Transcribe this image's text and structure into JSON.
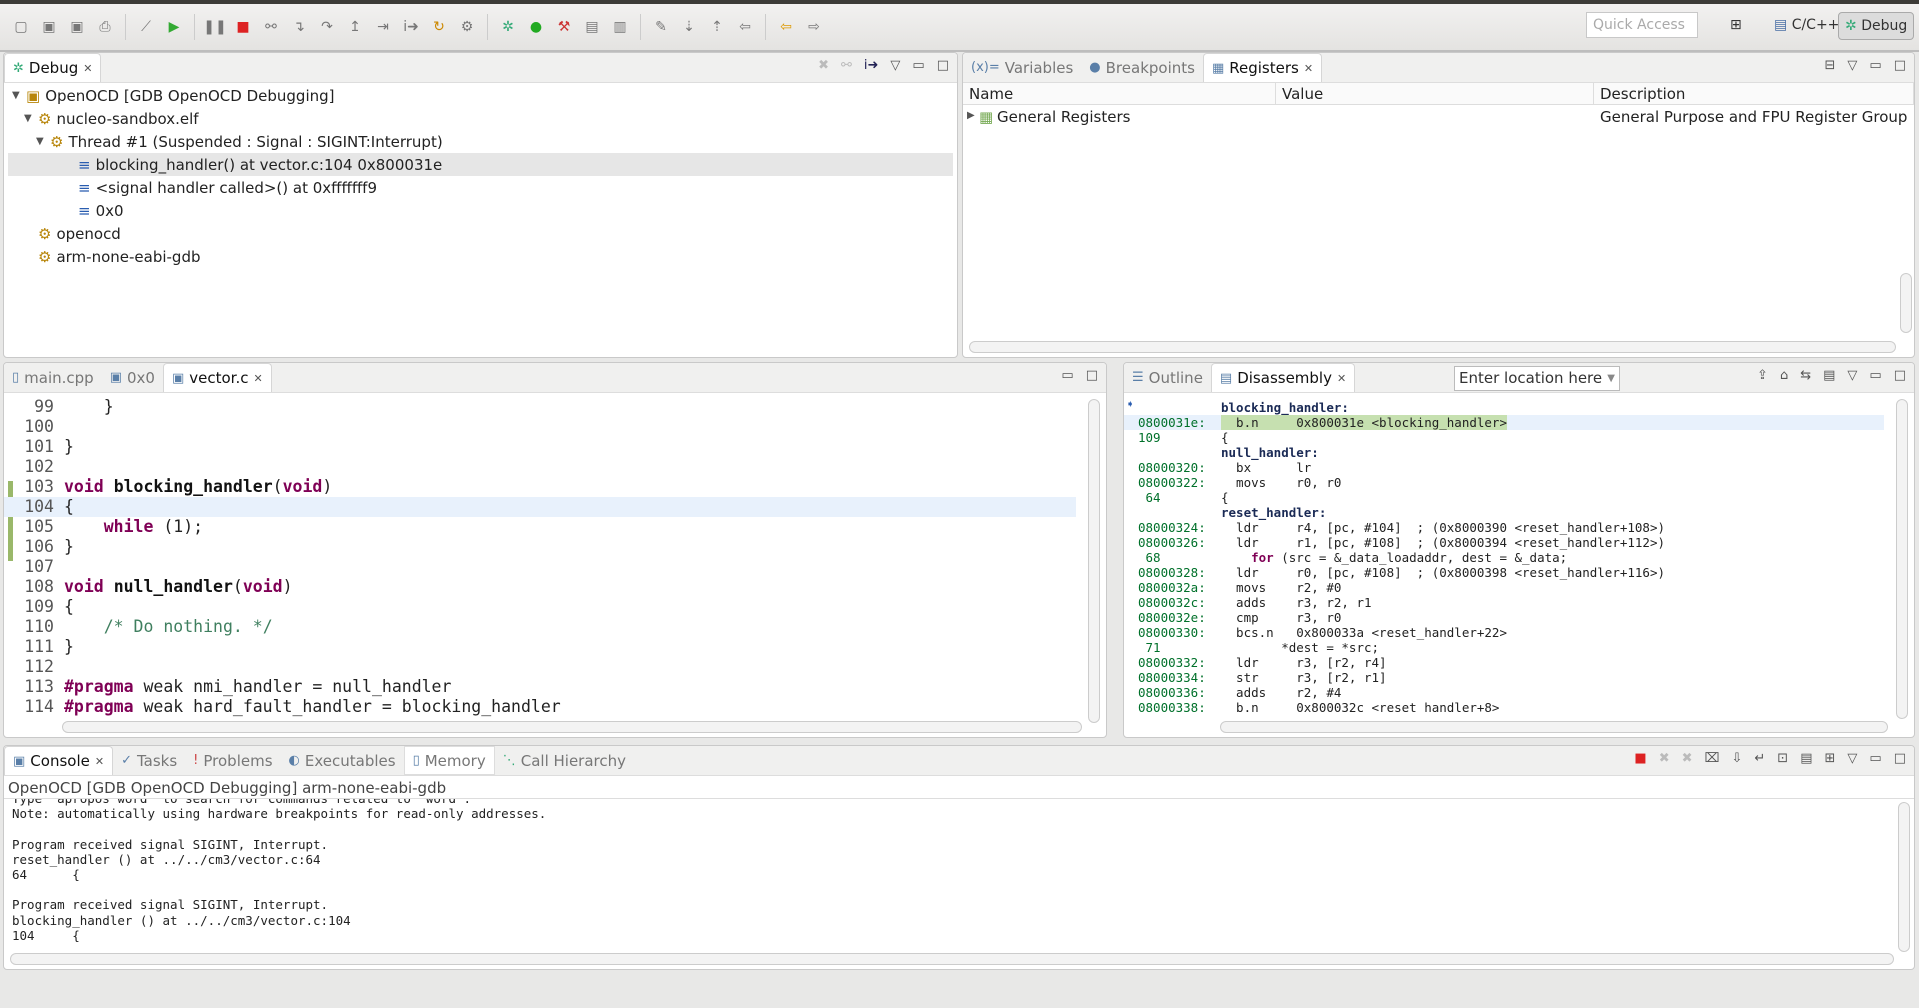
{
  "toolbar": {
    "quick_access_placeholder": "Quick Access",
    "perspectives": [
      "C/C++",
      "Debug"
    ],
    "icons": [
      "new",
      "save",
      "save-all",
      "print",
      "skip-breakpoints",
      "resume",
      "suspend",
      "terminate",
      "disconnect",
      "step-into",
      "step-over",
      "step-return",
      "drop-to-frame",
      "instruction-stepping",
      "run-last",
      "debug-config",
      "bug",
      "run",
      "external-tools",
      "open-type",
      "open-resource",
      "search",
      "next-annotation",
      "previous-annotation",
      "last-edit",
      "back",
      "forward"
    ]
  },
  "debug": {
    "tab": "Debug",
    "tree": [
      {
        "label": "OpenOCD [GDB OpenOCD Debugging]",
        "level": 0,
        "icon": "launch-icon"
      },
      {
        "label": "nucleo-sandbox.elf",
        "level": 1,
        "icon": "process-icon"
      },
      {
        "label": "Thread #1 (Suspended : Signal : SIGINT:Interrupt)",
        "level": 2,
        "icon": "thread-icon"
      },
      {
        "label": "blocking_handler() at vector.c:104 0x800031e",
        "level": 3,
        "icon": "stack-frame-icon",
        "selected": true
      },
      {
        "label": "<signal handler called>() at 0xfffffff9",
        "level": 3,
        "icon": "stack-frame-icon"
      },
      {
        "label": "0x0",
        "level": 3,
        "icon": "stack-frame-icon"
      },
      {
        "label": "openocd",
        "level": 1,
        "icon": "process-icon"
      },
      {
        "label": "arm-none-eabi-gdb",
        "level": 1,
        "icon": "process-icon"
      }
    ]
  },
  "registers": {
    "tabs": [
      "Variables",
      "Breakpoints",
      "Registers"
    ],
    "columns": [
      "Name",
      "Value",
      "Description"
    ],
    "rows": [
      {
        "name": "General Registers",
        "value": "",
        "description": "General Purpose and FPU Register Group"
      }
    ]
  },
  "editor": {
    "tabs": [
      "main.cpp",
      "0x0",
      "vector.c"
    ],
    "lines": [
      {
        "n": "99",
        "t": "    }"
      },
      {
        "n": "100",
        "t": ""
      },
      {
        "n": "101",
        "t": "}"
      },
      {
        "n": "102",
        "t": ""
      },
      {
        "n": "103",
        "t": "void blocking_handler(void)"
      },
      {
        "n": "104",
        "t": "{"
      },
      {
        "n": "105",
        "t": "    while (1);"
      },
      {
        "n": "106",
        "t": "}"
      },
      {
        "n": "107",
        "t": ""
      },
      {
        "n": "108",
        "t": "void null_handler(void)"
      },
      {
        "n": "109",
        "t": "{"
      },
      {
        "n": "110",
        "t": "    /* Do nothing. */"
      },
      {
        "n": "111",
        "t": "}"
      },
      {
        "n": "112",
        "t": ""
      },
      {
        "n": "113",
        "t": "#pragma weak nmi_handler = null_handler"
      },
      {
        "n": "114",
        "t": "#pragma weak hard_fault_handler = blocking_handler"
      }
    ]
  },
  "disassembly": {
    "tabs": [
      "Outline",
      "Disassembly"
    ],
    "location_placeholder": "Enter location here",
    "lines": [
      {
        "a": "",
        "t": "blocking_handler:",
        "label": true
      },
      {
        "a": "0800031e:",
        "t": "  b.n     0x800031e <blocking_handler>",
        "current": true
      },
      {
        "a": "109",
        "t": "{"
      },
      {
        "a": "",
        "t": "null_handler:",
        "label": true
      },
      {
        "a": "08000320:",
        "t": "  bx      lr"
      },
      {
        "a": "08000322:",
        "t": "  movs    r0, r0"
      },
      {
        "a": " 64",
        "t": "{"
      },
      {
        "a": "",
        "t": "reset_handler:",
        "label": true
      },
      {
        "a": "08000324:",
        "t": "  ldr     r4, [pc, #104]  ; (0x8000390 <reset_handler+108>)"
      },
      {
        "a": "08000326:",
        "t": "  ldr     r1, [pc, #108]  ; (0x8000394 <reset_handler+112>)"
      },
      {
        "a": " 68",
        "t": "    for (src = &_data_loadaddr, dest = &_data;"
      },
      {
        "a": "08000328:",
        "t": "  ldr     r0, [pc, #108]  ; (0x8000398 <reset_handler+116>)"
      },
      {
        "a": "0800032a:",
        "t": "  movs    r2, #0"
      },
      {
        "a": "0800032c:",
        "t": "  adds    r3, r2, r1"
      },
      {
        "a": "0800032e:",
        "t": "  cmp     r3, r0"
      },
      {
        "a": "08000330:",
        "t": "  bcs.n   0x800033a <reset_handler+22>"
      },
      {
        "a": " 71",
        "t": "        *dest = *src;"
      },
      {
        "a": "08000332:",
        "t": "  ldr     r3, [r2, r4]"
      },
      {
        "a": "08000334:",
        "t": "  str     r3, [r2, r1]"
      },
      {
        "a": "08000336:",
        "t": "  adds    r2, #4"
      },
      {
        "a": "08000338:",
        "t": "  b.n     0x800032c <reset_handler+8>"
      }
    ]
  },
  "console": {
    "tabs": [
      "Console",
      "Tasks",
      "Problems",
      "Executables",
      "Memory",
      "Call Hierarchy"
    ],
    "process": "OpenOCD [GDB OpenOCD Debugging] arm-none-eabi-gdb",
    "lines": [
      "Type \"apropos word\" to search for commands related to \"word\".",
      "Note: automatically using hardware breakpoints for read-only addresses.",
      "",
      "Program received signal SIGINT, Interrupt.",
      "reset_handler () at ../../cm3/vector.c:64",
      "64      {",
      "",
      "Program received signal SIGINT, Interrupt.",
      "blocking_handler () at ../../cm3/vector.c:104",
      "104     {"
    ]
  },
  "colors": {
    "keyword": "#7f0055",
    "comment": "#3f7f5f",
    "address": "#00702a",
    "current_line": "#e8f1fc",
    "pc_highlight": "#c6e0b0"
  }
}
